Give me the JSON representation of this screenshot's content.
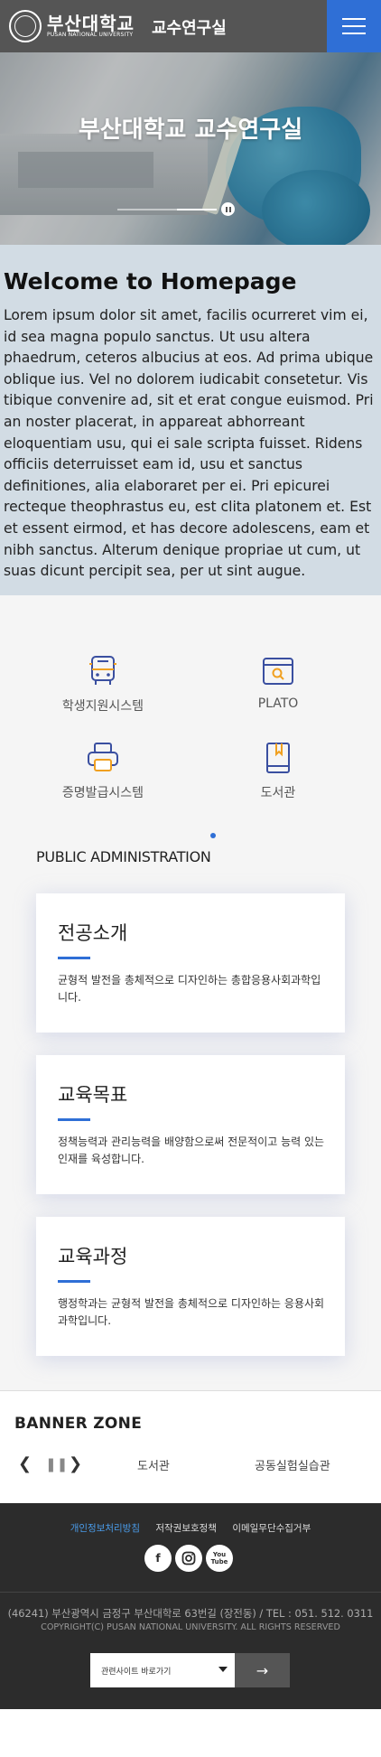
{
  "header": {
    "logo_ko": "부산대학교",
    "logo_en": "PUSAN NATIONAL UNIVERSITY",
    "site_name": "교수연구실"
  },
  "hero": {
    "title": "부산대학교 교수연구실",
    "progress": 0.4
  },
  "welcome": {
    "title": "Welcome to Homepage",
    "body": "Lorem ipsum dolor sit amet, facilis ocurreret vim ei, id sea magna populo sanctus. Ut usu altera phaedrum, ceteros albucius at eos. Ad prima ubique oblique ius. Vel no dolorem iudicabit consetetur. Vis tibique convenire ad, sit et erat congue euismod. Pri an noster placerat, in appareat abhorreant eloquentiam usu, qui ei sale scripta fuisset. Ridens officiis deterruisset eam id, usu et sanctus definitiones, alia elaboraret per ei. Pri epicurei recteque theophrastus eu, est clita platonem et. Est et essent eirmod, et has decore adolescens, eam et nibh sanctus. Alterum denique propriae ut cum, ut suas dicunt percipit sea, per ut sint augue."
  },
  "quick_links": [
    {
      "label": "학생지원시스템",
      "icon": "bus-icon"
    },
    {
      "label": "PLATO",
      "icon": "browser-search-icon"
    },
    {
      "label": "증명발급시스템",
      "icon": "printer-icon"
    },
    {
      "label": "도서관",
      "icon": "book-icon"
    }
  ],
  "public_admin": {
    "title": "PUBLIC ADMINISTRATION",
    "cards": [
      {
        "title": "전공소개",
        "text": "균형적 발전을 총체적으로 디자인하는 총합응용사회과학입니다."
      },
      {
        "title": "교육목표",
        "text": "정책능력과 관리능력을 배양함으로써 전문적이고 능력 있는 인재를 육성합니다."
      },
      {
        "title": "교육과정",
        "text": "행정학과는 균형적 발전을 총체적으로 디자인하는 응용사회과학입니다."
      }
    ]
  },
  "banner": {
    "title": "BANNER ZONE",
    "links": [
      "도서관",
      "공동실험실습관"
    ]
  },
  "footer": {
    "links": [
      "개인정보처리방침",
      "저작권보호정책",
      "이메일무단수집거부"
    ],
    "sns": [
      "f",
      "ig",
      "You Tube"
    ],
    "address": "(46241) 부산광역시 금정구 부산대학로 63번길 (장전동) / TEL : 051. 512. 0311",
    "copyright": "COPYRIGHT(C) PUSAN NATIONAL UNIVERSITY. ALL RIGHTS RESERVED",
    "select_label": "관련사이트 바로가기",
    "go_label": "→"
  },
  "colors": {
    "accent": "#2f6fd6",
    "welcome_bg": "#d2dce4",
    "footer_bg": "#2c2c2c",
    "highlight_link": "#4a9be8"
  }
}
